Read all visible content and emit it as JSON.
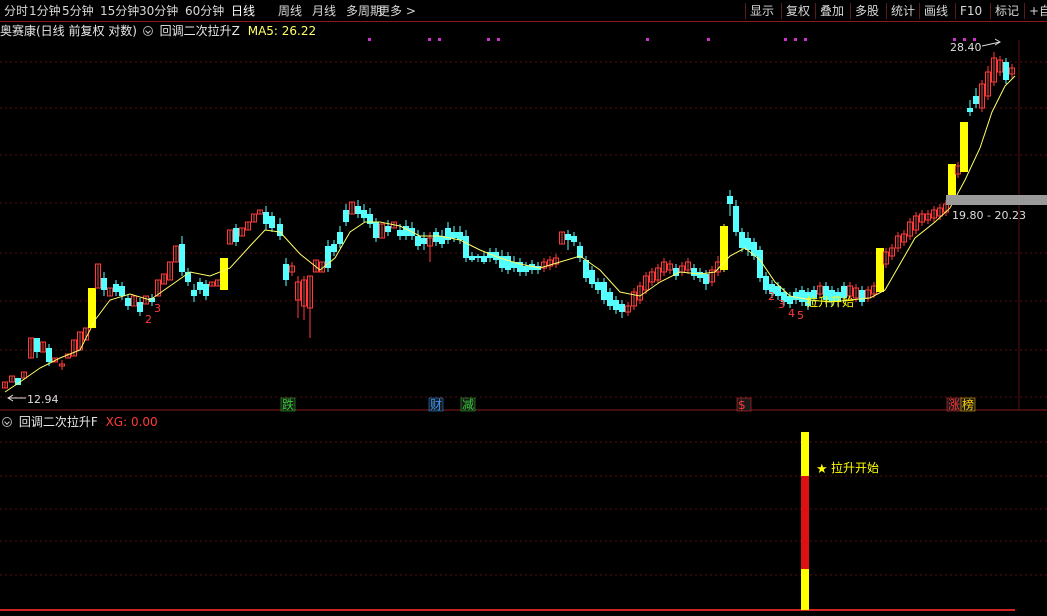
{
  "toolbar": {
    "left_items": [
      "分时",
      "1分钟",
      "5分钟",
      "15分钟",
      "30分钟",
      "60分钟",
      "日线",
      "周线",
      "月线",
      "多周期",
      "更多 >"
    ],
    "active_item": "日线",
    "right_items": [
      "显示",
      "复权",
      "叠加",
      "多股",
      "统计",
      "画线",
      "F10",
      "标记",
      "+自"
    ]
  },
  "main_chart": {
    "stock_title": "奥赛康(日线 前复权 对数)",
    "indicator_name": "回调二次拉升Z",
    "ma_label": "MA5: 26.22",
    "high_price_label": "28.40",
    "low_price_label": "12.94",
    "range_label": "19.80 - 20.23",
    "annotations": [
      {
        "text": "2"
      },
      {
        "text": "3"
      },
      {
        "text": "2"
      },
      {
        "text": "3"
      },
      {
        "text": "4"
      },
      {
        "text": "5"
      }
    ],
    "signal_text": "拉升开始",
    "event_markers": [
      {
        "text": "跌",
        "color": "#33cc33"
      },
      {
        "text": "财",
        "color": "#3399ff"
      },
      {
        "text": "减",
        "color": "#33cc33"
      },
      {
        "text": "$",
        "color": "#ff3333"
      },
      {
        "text": "涨",
        "color": "#ff3333"
      },
      {
        "text": "榜",
        "color": "#ffcc00"
      }
    ]
  },
  "sub_chart": {
    "indicator_name": "回调二次拉升F",
    "xg_label": "XG: 0.00",
    "signal_text": "拉升开始"
  },
  "colors": {
    "up": "#ff3b3b",
    "down": "#54ffff",
    "signal": "#ffff00",
    "ma": "#ffff66",
    "grid": "#5a0f0f",
    "dot": "#cc33cc"
  }
}
